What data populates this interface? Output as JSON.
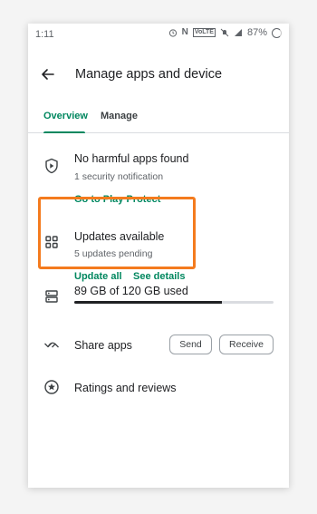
{
  "status_bar": {
    "time": "1:11",
    "battery": "87%",
    "icons": [
      "alarm-icon",
      "nfc-icon",
      "volte-icon",
      "mute-icon",
      "signal-icon",
      "battery-icon"
    ]
  },
  "header": {
    "title": "Manage apps and device"
  },
  "tabs": [
    {
      "label": "Overview",
      "selected": true
    },
    {
      "label": "Manage",
      "selected": false
    }
  ],
  "protect": {
    "title": "No harmful apps found",
    "subtitle": "1 security notification",
    "link": "Go to Play Protect"
  },
  "updates": {
    "title": "Updates available",
    "subtitle": "5 updates pending",
    "update_all": "Update all",
    "see_details": "See details"
  },
  "storage": {
    "label": "89 GB of 120 GB used",
    "used_fraction": 0.742
  },
  "share": {
    "label": "Share apps",
    "send": "Send",
    "receive": "Receive"
  },
  "ratings": {
    "label": "Ratings and reviews"
  },
  "colors": {
    "accent": "#01875f",
    "highlight": "#f47b1e"
  }
}
